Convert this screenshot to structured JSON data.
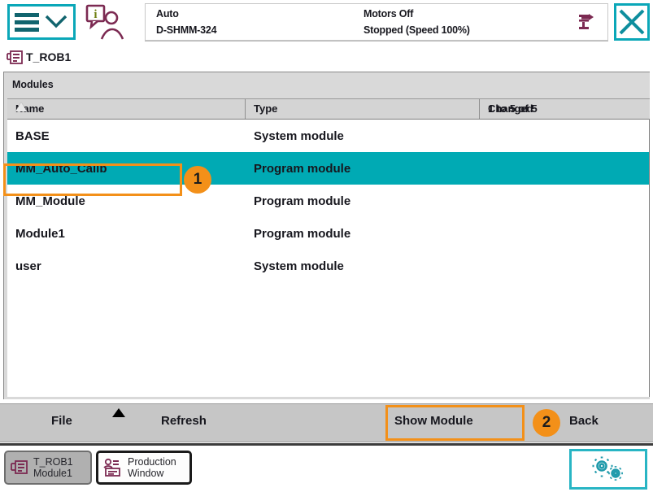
{
  "header": {
    "menu_icon": "hamburger-menu-icon",
    "chevron_icon": "chevron-down-icon",
    "info_icon": "operator-info-icon",
    "close_label": "✕",
    "close_icon": "close-icon",
    "robot_icon": "robot-stopped-icon",
    "status": {
      "mode": "Auto",
      "controller": "D-SHMM-324",
      "motors": "Motors Off",
      "execution": "Stopped (Speed 100%)"
    }
  },
  "task_tab": {
    "icon": "task-module-icon",
    "label": "T_ROB1"
  },
  "panel": {
    "title": "Modules",
    "pager": "1 to 5 of 5",
    "columns": [
      {
        "key": "name",
        "label": "Name",
        "sorted": "asc"
      },
      {
        "key": "type",
        "label": "Type"
      },
      {
        "key": "changed",
        "label": "Changed"
      }
    ],
    "rows": [
      {
        "name": "BASE",
        "type": "System module",
        "changed": "",
        "selected": false
      },
      {
        "name": "MM_Auto_Calib",
        "type": "Program module",
        "changed": "",
        "selected": true
      },
      {
        "name": "MM_Module",
        "type": "Program module",
        "changed": "",
        "selected": false
      },
      {
        "name": "Module1",
        "type": "Program module",
        "changed": "",
        "selected": false
      },
      {
        "name": "user",
        "type": "System module",
        "changed": "",
        "selected": false
      }
    ]
  },
  "action_bar": {
    "file_label": "File",
    "refresh_label": "Refresh",
    "show_module_label": "Show Module",
    "back_label": "Back",
    "caret_icon": "caret-up-icon"
  },
  "taskbar": {
    "buttons": [
      {
        "icon": "task-module-icon",
        "line1": "T_ROB1",
        "line2": "Module1",
        "state": "inactive"
      },
      {
        "icon": "production-window-icon",
        "line1": "Production",
        "line2": "Window",
        "state": "active"
      }
    ],
    "quickset_icon": "gears-icon"
  },
  "annotations": [
    {
      "number": "1",
      "target": "selected-row-name-cell"
    },
    {
      "number": "2",
      "target": "show-module-button"
    }
  ],
  "colors": {
    "accent_teal": "#00aab4",
    "brand_teal": "#0aa7b8",
    "annotation_orange": "#f39019",
    "icon_maroon": "#7c2a52",
    "pager_purple": "#8d44d8",
    "bar_gray": "#c6c6c6",
    "panel_gray": "#d9d9d9"
  }
}
